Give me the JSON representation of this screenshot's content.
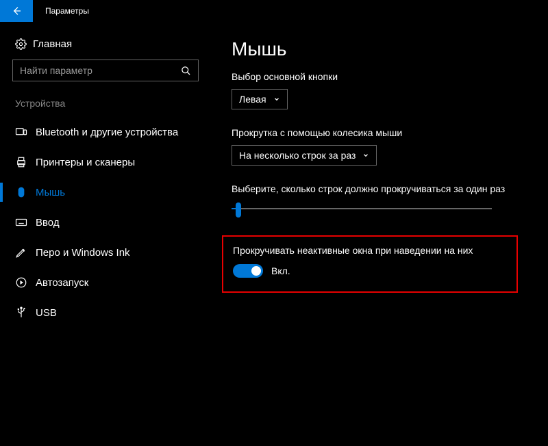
{
  "titlebar": {
    "title": "Параметры"
  },
  "sidebar": {
    "home": "Главная",
    "searchPlaceholder": "Найти параметр",
    "section": "Устройства",
    "items": [
      {
        "label": "Bluetooth и другие устройства",
        "icon": "devices"
      },
      {
        "label": "Принтеры и сканеры",
        "icon": "printer"
      },
      {
        "label": "Мышь",
        "icon": "mouse",
        "active": true
      },
      {
        "label": "Ввод",
        "icon": "keyboard"
      },
      {
        "label": "Перо и Windows Ink",
        "icon": "pen"
      },
      {
        "label": "Автозапуск",
        "icon": "autoplay"
      },
      {
        "label": "USB",
        "icon": "usb"
      }
    ]
  },
  "main": {
    "heading": "Мышь",
    "primaryButton": {
      "label": "Выбор основной кнопки",
      "value": "Левая"
    },
    "scrollMode": {
      "label": "Прокрутка с помощью колесика мыши",
      "value": "На несколько строк за раз"
    },
    "linesLabel": "Выберите, сколько строк должно прокручиваться за один раз",
    "inactiveScroll": {
      "label": "Прокручивать неактивные окна при наведении на них",
      "state": "Вкл."
    }
  }
}
